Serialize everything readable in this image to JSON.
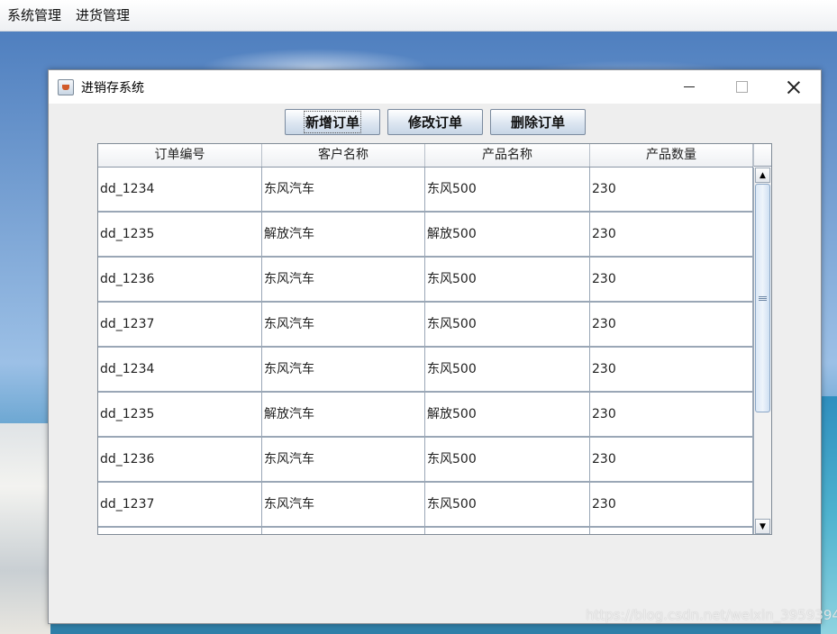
{
  "menubar": {
    "items": [
      "系统管理",
      "进货管理"
    ]
  },
  "window": {
    "title": "进销存系统"
  },
  "toolbar": {
    "add_label": "新增订单",
    "edit_label": "修改订单",
    "delete_label": "删除订单"
  },
  "table": {
    "columns": [
      "订单编号",
      "客户名称",
      "产品名称",
      "产品数量"
    ],
    "rows": [
      [
        "dd_1234",
        "东风汽车",
        "东风500",
        "230"
      ],
      [
        "dd_1235",
        "解放汽车",
        "解放500",
        "230"
      ],
      [
        "dd_1236",
        "东风汽车",
        "东风500",
        "230"
      ],
      [
        "dd_1237",
        "东风汽车",
        "东风500",
        "230"
      ],
      [
        "dd_1234",
        "东风汽车",
        "东风500",
        "230"
      ],
      [
        "dd_1235",
        "解放汽车",
        "解放500",
        "230"
      ],
      [
        "dd_1236",
        "东风汽车",
        "东风500",
        "230"
      ],
      [
        "dd_1237",
        "东风汽车",
        "东风500",
        "230"
      ],
      [
        "",
        "",
        "",
        ""
      ]
    ]
  },
  "watermark": "https://blog.csdn.net/weixin_39593940"
}
